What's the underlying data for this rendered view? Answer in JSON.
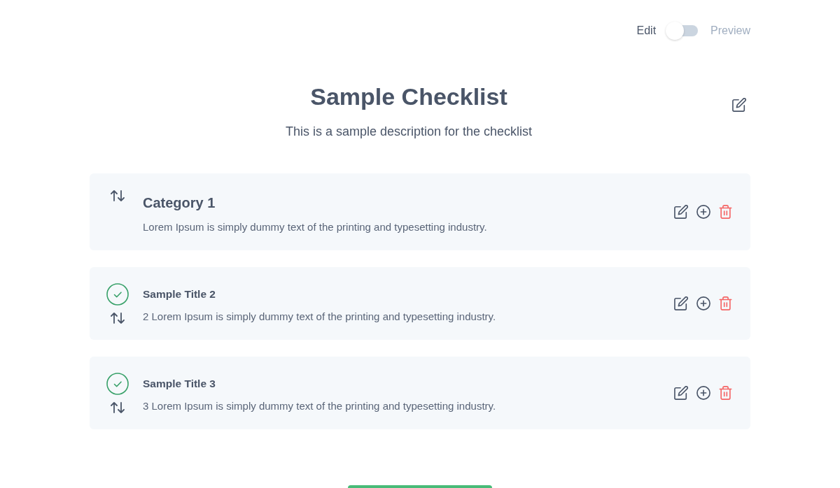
{
  "mode_toggle": {
    "left_label": "Edit",
    "right_label": "Preview",
    "on": false
  },
  "checklist": {
    "title": "Sample Checklist",
    "description": "This is a sample description for the checklist"
  },
  "entries": [
    {
      "kind": "category",
      "title": "Category 1",
      "description": "Lorem Ipsum is simply dummy text of the printing and typesetting industry."
    },
    {
      "kind": "item",
      "title": "Sample Title 2",
      "description": "2 Lorem Ipsum is simply dummy text of the printing and typesetting industry.",
      "checked": true
    },
    {
      "kind": "item",
      "title": "Sample Title 3",
      "description": "3 Lorem Ipsum is simply dummy text of the printing and typesetting industry.",
      "checked": true
    }
  ]
}
